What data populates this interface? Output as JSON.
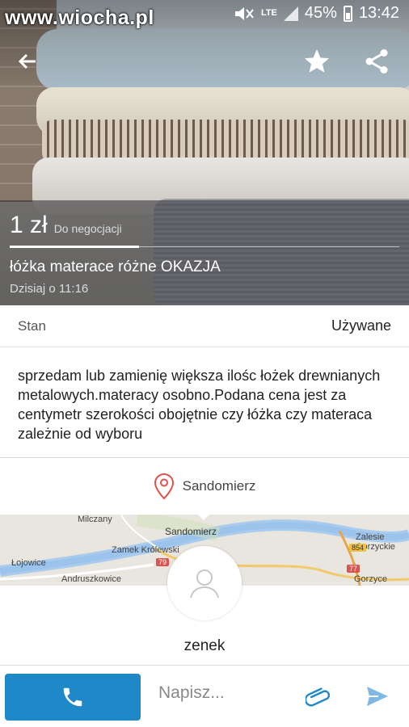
{
  "status_bar": {
    "watermark": "www.wiocha.pl",
    "network": "LTE",
    "battery": "45%",
    "time": "13:42"
  },
  "toolbar": {
    "back_icon": "arrow-left-icon",
    "favorite_icon": "star-icon",
    "share_icon": "share-icon"
  },
  "listing": {
    "price": "1 zł",
    "price_note": "Do negocjacji",
    "title": "łóżka materace różne OKAZJA",
    "date": "Dzisiaj o 11:16"
  },
  "details": {
    "condition_label": "Stan",
    "condition_value": "Używane"
  },
  "description": "sprzedam lub zamienię większa ilośc łożek drewnianych metalowych.materacy osobno.Podana cena  jest za centymetr szerokości obojętnie czy łóżka czy materaca zależnie od wyboru",
  "location": {
    "city": "Sandomierz",
    "icon": "map-pin-icon"
  },
  "map": {
    "labels": [
      "Milczany",
      "Sandomierz",
      "Zamek Królewski",
      "Zalesie Gorzyckie",
      "Łojowice",
      "Andruszkowice",
      "Gorzyce"
    ],
    "roads": [
      "79",
      "854",
      "77"
    ]
  },
  "seller": {
    "name": "zenek",
    "avatar_icon": "user-avatar-icon"
  },
  "bottom_bar": {
    "call_icon": "phone-icon",
    "message_placeholder": "Napisz...",
    "attach_icon": "paperclip-icon",
    "send_icon": "send-icon"
  },
  "colors": {
    "accent": "#1e88c8",
    "pin": "#e0524b"
  }
}
